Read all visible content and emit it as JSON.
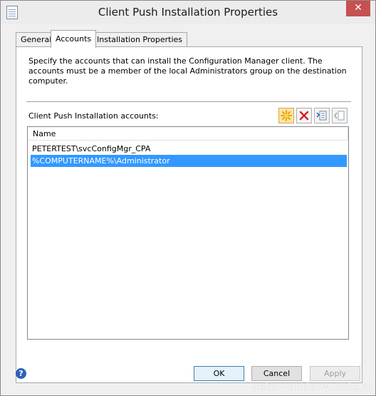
{
  "window": {
    "title": "Client Push Installation Properties",
    "close_glyph": "✕"
  },
  "tabs": [
    {
      "label": "General",
      "active": false
    },
    {
      "label": "Accounts",
      "active": true
    },
    {
      "label": "Installation Properties",
      "active": false
    }
  ],
  "accounts_tab": {
    "description": "Specify the accounts that can install the Configuration Manager client. The accounts must be a member of the local Administrators group on the destination computer.",
    "section_label": "Client Push Installation accounts:",
    "toolbar": {
      "new_icon": "new-account-icon",
      "delete_icon": "delete-icon",
      "properties_icon": "properties-icon",
      "move_icon": "move-icon"
    },
    "list": {
      "column": "Name",
      "rows": [
        {
          "name": "PETERTEST\\svcConfigMgr_CPA",
          "selected": false
        },
        {
          "name": "%COMPUTERNAME%\\Administrator",
          "selected": true
        }
      ]
    }
  },
  "footer": {
    "help_glyph": "?",
    "ok_label": "OK",
    "cancel_label": "Cancel",
    "apply_label": "Apply"
  },
  "watermark": "petervanderwoude.nl",
  "colors": {
    "selection": "#3399ff",
    "close_button": "#c75050"
  }
}
